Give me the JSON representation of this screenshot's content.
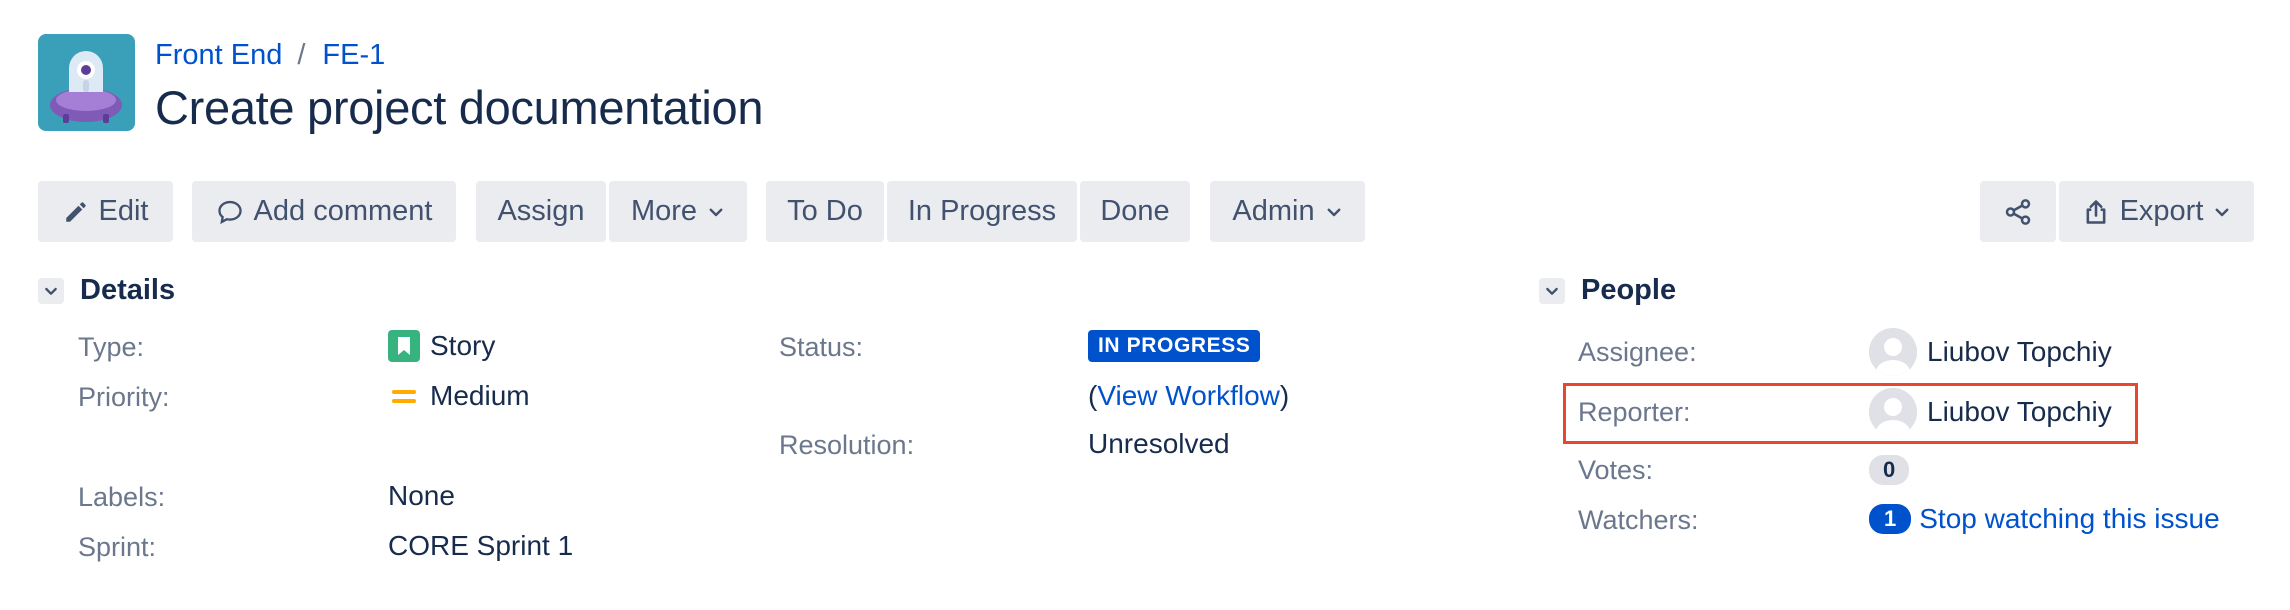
{
  "breadcrumb": {
    "project": "Front End",
    "separator": "/",
    "issue_key": "FE-1"
  },
  "issue": {
    "summary": "Create project documentation"
  },
  "toolbar": {
    "edit": "Edit",
    "add_comment": "Add comment",
    "assign": "Assign",
    "more": "More",
    "to_do": "To Do",
    "in_progress": "In Progress",
    "done": "Done",
    "admin": "Admin",
    "export": "Export"
  },
  "details": {
    "heading": "Details",
    "type_label": "Type:",
    "type_value": "Story",
    "priority_label": "Priority:",
    "priority_value": "Medium",
    "labels_label": "Labels:",
    "labels_value": "None",
    "sprint_label": "Sprint:",
    "sprint_value": "CORE Sprint 1",
    "status_label": "Status:",
    "status_value": "IN PROGRESS",
    "view_workflow_open": "(",
    "view_workflow": "View Workflow",
    "view_workflow_close": ")",
    "resolution_label": "Resolution:",
    "resolution_value": "Unresolved"
  },
  "people": {
    "heading": "People",
    "assignee_label": "Assignee:",
    "assignee_value": "Liubov Topchiy",
    "reporter_label": "Reporter:",
    "reporter_value": "Liubov Topchiy",
    "votes_label": "Votes:",
    "votes_value": "0",
    "watchers_label": "Watchers:",
    "watchers_count": "1",
    "watch_link": "Stop watching this issue"
  },
  "colors": {
    "link": "#0052cc",
    "status_lozenge": "#0052cc",
    "story_icon": "#36b37e",
    "priority_medium": "#ffab00",
    "highlight_box": "#e5482d"
  },
  "icons": [
    "pencil-icon",
    "comment-icon",
    "chevron-down-icon",
    "share-icon",
    "export-icon",
    "story-icon",
    "priority-medium-icon",
    "user-avatar-icon"
  ]
}
